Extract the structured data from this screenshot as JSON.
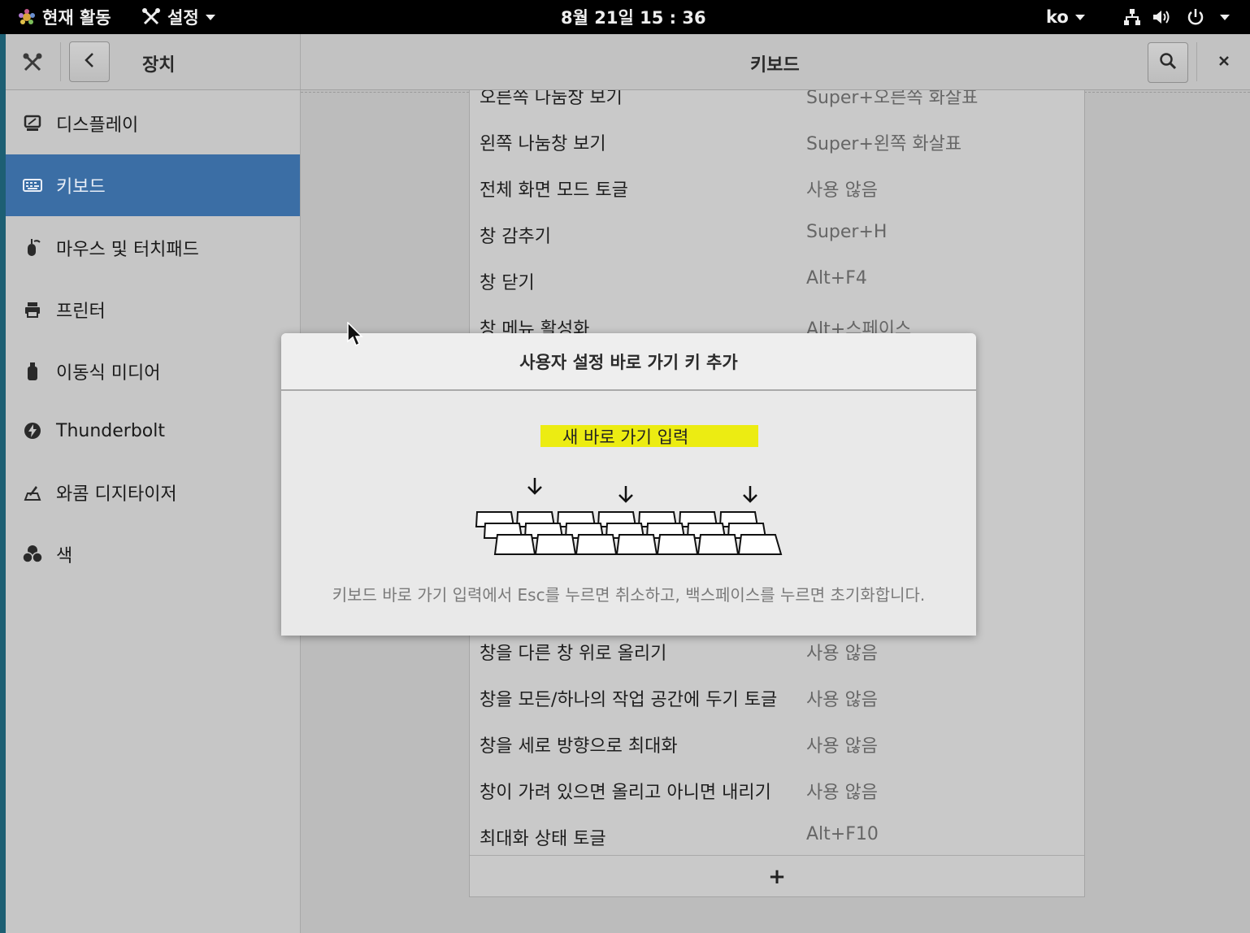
{
  "topbar": {
    "activities": "현재 활동",
    "app_menu": "설정",
    "clock": "8월 21일  15 : 36",
    "language": "ko"
  },
  "header": {
    "section_title": "장치",
    "page_title": "키보드"
  },
  "sidebar": {
    "items": [
      {
        "label": "디스플레이",
        "icon": "display-icon"
      },
      {
        "label": "키보드",
        "icon": "keyboard-icon",
        "active": true
      },
      {
        "label": "마우스 및 터치패드",
        "icon": "mouse-icon"
      },
      {
        "label": "프린터",
        "icon": "printer-icon"
      },
      {
        "label": "이동식 미디어",
        "icon": "removable-media-icon"
      },
      {
        "label": "Thunderbolt",
        "icon": "thunderbolt-icon"
      },
      {
        "label": "와콤 디지타이저",
        "icon": "wacom-tablet-icon"
      },
      {
        "label": "색",
        "icon": "color-icon"
      }
    ]
  },
  "shortcuts": {
    "rows": [
      {
        "name": "오른쪽 나눔창 보기",
        "key": "Super+오른쪽 화살표"
      },
      {
        "name": "왼쪽 나눔창 보기",
        "key": "Super+왼쪽 화살표"
      },
      {
        "name": "전체 화면 모드 토글",
        "key": "사용 않음"
      },
      {
        "name": "창 감추기",
        "key": "Super+H"
      },
      {
        "name": "창 닫기",
        "key": "Alt+F4"
      },
      {
        "name": "창 메뉴 활성화",
        "key": "Alt+스페이스"
      },
      {
        "name": "창을 다른 창 위로 올리기",
        "key": "사용 않음"
      },
      {
        "name": "창을 모든/하나의 작업 공간에 두기 토글",
        "key": "사용 않음"
      },
      {
        "name": "창을 세로 방향으로 최대화",
        "key": "사용 않음"
      },
      {
        "name": "창이 가려 있으면 올리고 아니면 내리기",
        "key": "사용 않음"
      },
      {
        "name": "최대화 상태 토글",
        "key": "Alt+F10"
      }
    ],
    "add_label": "+"
  },
  "dialog": {
    "title": "사용자 설정 바로 가기 키 추가",
    "prompt": "새 바로 가기 입력",
    "hint": "키보드 바로 가기 입력에서 Esc를 누르면 취소하고, 백스페이스를 누르면 초기화합니다.",
    "highlight_color": "#ecec12"
  },
  "colors": {
    "accent": "#3b6ea5"
  }
}
